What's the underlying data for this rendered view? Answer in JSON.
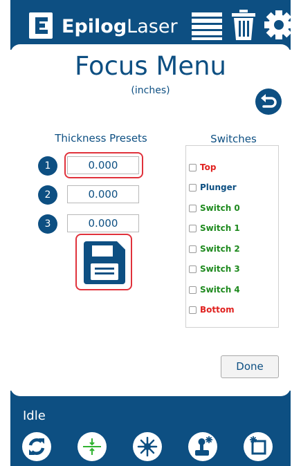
{
  "header": {
    "brand_bold": "Epilog",
    "brand_light": "Laser",
    "icons": [
      "list-icon",
      "trash-icon",
      "gear-icon"
    ]
  },
  "main": {
    "title": "Focus Menu",
    "units": "(inches)",
    "presets": {
      "title": "Thickness Presets",
      "items": [
        {
          "number": "1",
          "value": "0.000"
        },
        {
          "number": "2",
          "value": "0.000"
        },
        {
          "number": "3",
          "value": "0.000"
        }
      ]
    },
    "switches": {
      "title": "Switches",
      "items": [
        {
          "label": "Top",
          "color": "#e0211f"
        },
        {
          "label": "Plunger",
          "color": "#0d4f82"
        },
        {
          "label": "Switch 0",
          "color": "#1f8a1f"
        },
        {
          "label": "Switch 1",
          "color": "#1f8a1f"
        },
        {
          "label": "Switch 2",
          "color": "#1f8a1f"
        },
        {
          "label": "Switch 3",
          "color": "#1f8a1f"
        },
        {
          "label": "Switch 4",
          "color": "#1f8a1f"
        },
        {
          "label": "Bottom",
          "color": "#e0211f"
        }
      ]
    },
    "done_label": "Done"
  },
  "footer": {
    "status": "Idle",
    "buttons": [
      "refresh-icon",
      "focus-crosshair-icon",
      "laser-icon",
      "joystick-icon",
      "laser-window-icon"
    ]
  },
  "colors": {
    "brand": "#0d4f82",
    "highlight": "#e0313b"
  }
}
